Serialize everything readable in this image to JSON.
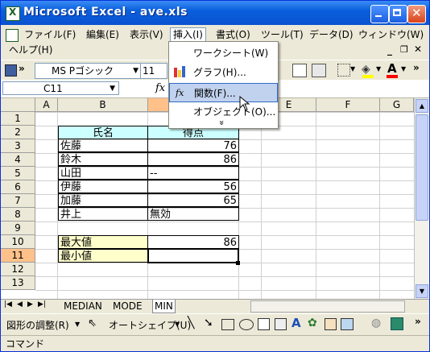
{
  "window": {
    "title": "Microsoft Excel - ave.xls"
  },
  "menubar": {
    "items": [
      "ファイル(F)",
      "編集(E)",
      "表示(V)",
      "挿入(I)",
      "書式(O)",
      "ツール(T)",
      "データ(D)",
      "ウィンドウ(W)"
    ],
    "help": "ヘルプ(H)"
  },
  "toolbar": {
    "font_name": "MS Pゴシック",
    "font_size": "11"
  },
  "formula": {
    "name_box": "C11",
    "fx": "fx"
  },
  "insert_menu": {
    "items": [
      "ワークシート(W)",
      "グラフ(H)...",
      "関数(F)...",
      "オブジェクト(O)..."
    ],
    "selected": "関数(F)...",
    "expand": "»"
  },
  "sheet": {
    "columns": [
      "A",
      "B",
      "C",
      "D",
      "E",
      "F",
      "G"
    ],
    "rows": [
      "1",
      "2",
      "3",
      "4",
      "5",
      "6",
      "7",
      "8",
      "9",
      "10",
      "11",
      "12",
      "13"
    ],
    "header_name": "氏名",
    "header_score": "得点",
    "data": [
      {
        "name": "佐藤",
        "score": "76"
      },
      {
        "name": "鈴木",
        "score": "86"
      },
      {
        "name": "山田",
        "score": "--"
      },
      {
        "name": "伊藤",
        "score": "56"
      },
      {
        "name": "加藤",
        "score": "65"
      },
      {
        "name": "井上",
        "score": "無効"
      }
    ],
    "max_label": "最大値",
    "max_value": "86",
    "min_label": "最小値",
    "min_value": "",
    "label_bg": "#ffffcc",
    "header_bg": "#ccffff"
  },
  "tabs": {
    "items": [
      "MEDIAN",
      "MODE",
      "MIN"
    ],
    "active": "MIN"
  },
  "drawbar": {
    "draw_label": "図形の調整(R)",
    "autoshape_label": "オートシェイプ(U)"
  },
  "status": {
    "text": "コマンド"
  }
}
